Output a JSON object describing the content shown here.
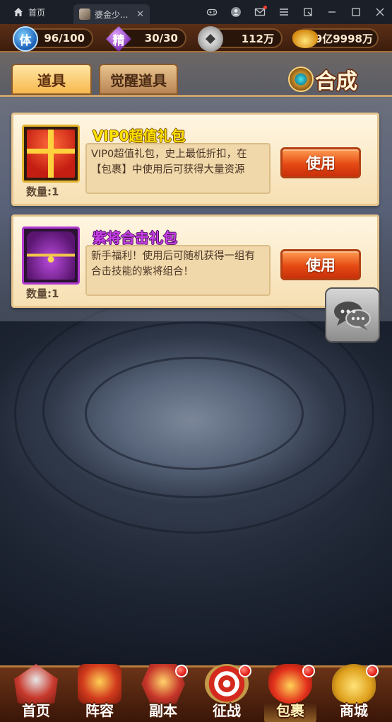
{
  "chrome": {
    "home_tab": "首页",
    "game_tab_title": "婆金少...",
    "close_glyph": "✕",
    "actions": [
      "gamepad-icon",
      "user-icon",
      "mail-icon",
      "menu-icon",
      "pip-icon",
      "minimize-icon",
      "maximize-icon",
      "close-icon"
    ]
  },
  "resources": {
    "stamina": {
      "icon_label": "体",
      "value": "96/100"
    },
    "spirit": {
      "icon_label": "精",
      "value": "30/30"
    },
    "coins": {
      "value": "112万"
    },
    "ingots": {
      "value": "9亿9998万"
    }
  },
  "tabs": {
    "items": "道具",
    "awaken_items": "觉醒道具",
    "synthesize": "合成"
  },
  "items": [
    {
      "name": "VIP0超值礼包",
      "description": "VIP0超值礼包，史上最低折扣，在【包裹】中使用后可获得大量资源",
      "quantity": "数量:1",
      "button": "使用",
      "rarity": "gold"
    },
    {
      "name": "紫将合击礼包",
      "description": "新手福利！使用后可随机获得一组有合击技能的紫将组合！",
      "quantity": "数量:1",
      "button": "使用",
      "rarity": "purple"
    }
  ],
  "bottom_nav": [
    {
      "label": "首页",
      "icon": "home-icon",
      "badge": false,
      "active": false
    },
    {
      "label": "阵容",
      "icon": "lineup-icon",
      "badge": false,
      "active": false
    },
    {
      "label": "副本",
      "icon": "dungeon-icon",
      "badge": true,
      "active": false
    },
    {
      "label": "征战",
      "icon": "battle-icon",
      "badge": true,
      "active": false
    },
    {
      "label": "包裹",
      "icon": "bag-icon",
      "badge": true,
      "active": true
    },
    {
      "label": "商城",
      "icon": "shop-icon",
      "badge": true,
      "active": false
    }
  ],
  "colors": {
    "accent_gold": "#ffe400",
    "accent_purple": "#c941e9",
    "button_orange": "#e54a14",
    "badge_red": "#e0140f"
  }
}
